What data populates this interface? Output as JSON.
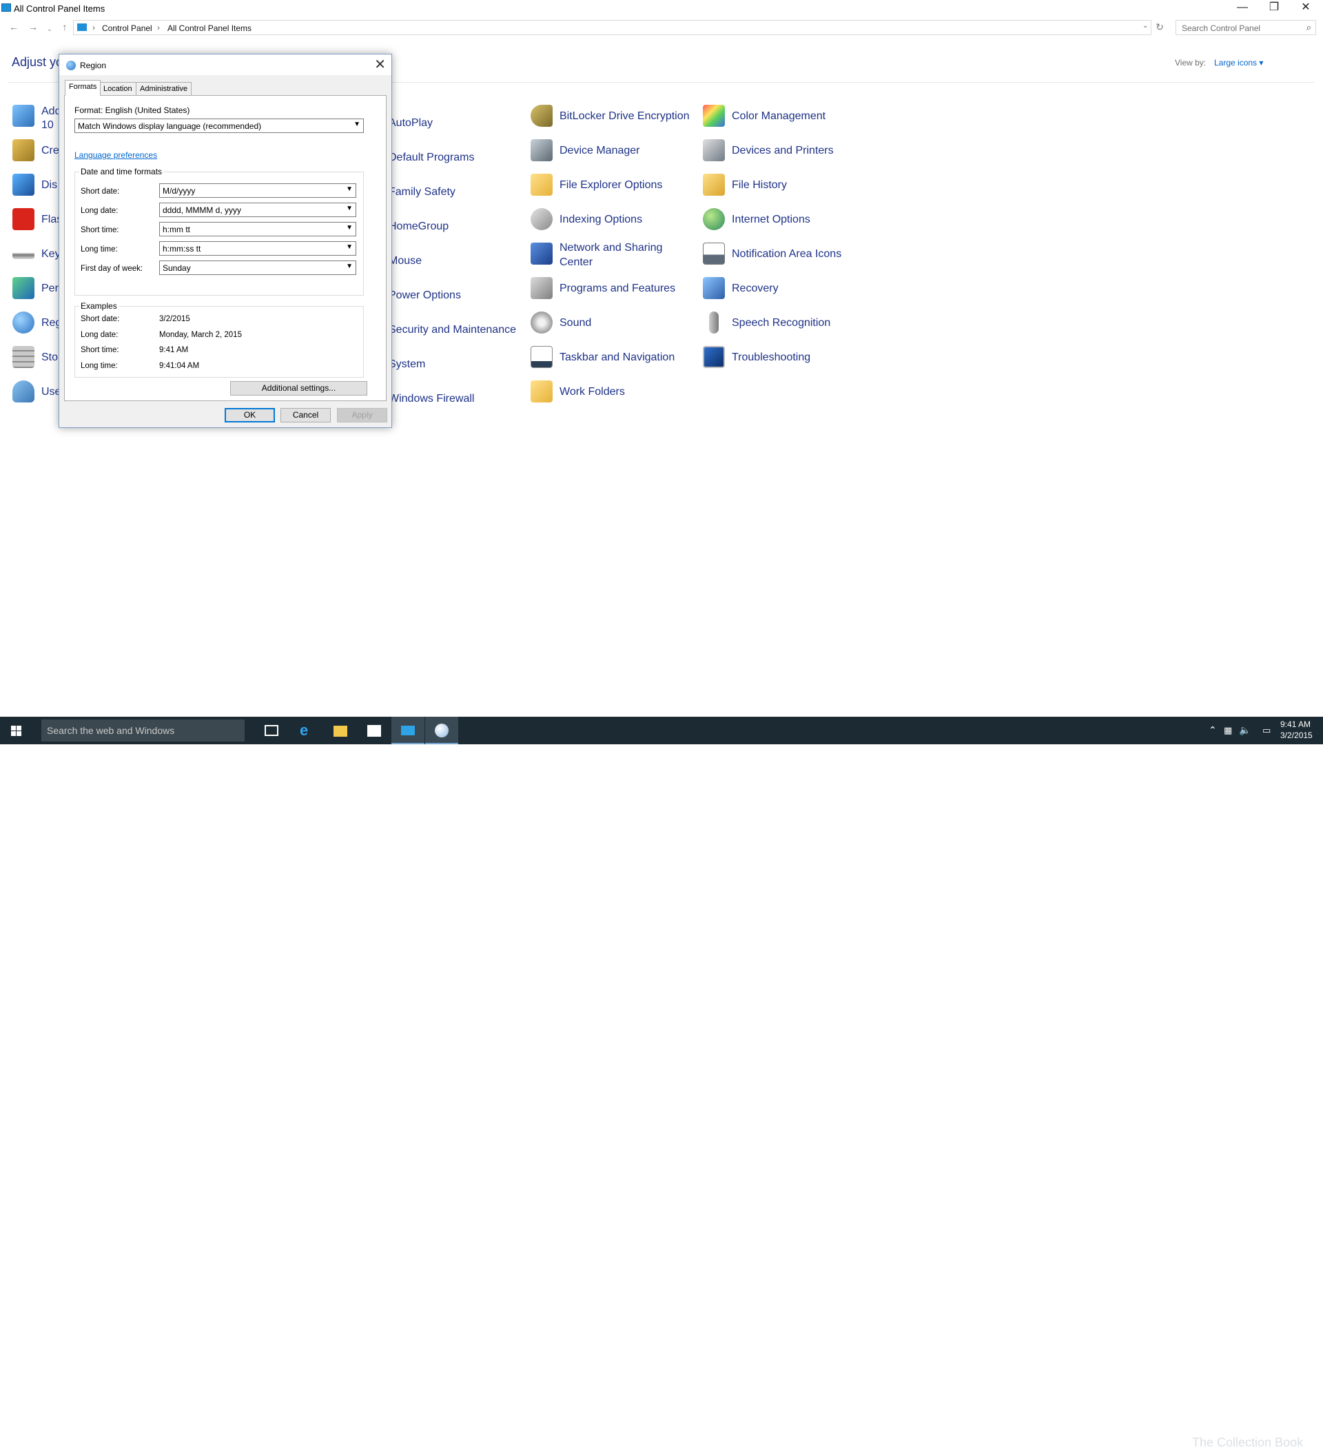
{
  "window": {
    "title": "All Control Panel Items",
    "minimize_glyph": "—",
    "restore_glyph": "❐",
    "close_glyph": "✕"
  },
  "address": {
    "crumbs": [
      "Control Panel",
      "All Control Panel Items"
    ],
    "search_placeholder": "Search Control Panel"
  },
  "header": {
    "title_partial": "Adjust you",
    "view_by_label": "View by:",
    "view_by_value": "Large icons ▾"
  },
  "items": {
    "col0": [
      "Add",
      "10",
      "Cre",
      "Dis",
      "Flas",
      "Key",
      "Per",
      "Reg",
      "Sto",
      "Use"
    ],
    "col1": [
      "AutoPlay",
      "Default Programs",
      "Family Safety",
      "HomeGroup",
      "Mouse",
      "Power Options",
      "Security and Maintenance",
      "System",
      "Windows Firewall"
    ],
    "col2": [
      "BitLocker Drive Encryption",
      "Device Manager",
      "File Explorer Options",
      "Indexing Options",
      "Network and Sharing",
      "Center",
      "Programs and Features",
      "Sound",
      "Taskbar and Navigation",
      "Work Folders"
    ],
    "col3": [
      "Color Management",
      "Devices and Printers",
      "File History",
      "Internet Options",
      "Notification Area Icons",
      "Recovery",
      "Speech Recognition",
      "Troubleshooting"
    ]
  },
  "dialog": {
    "title": "Region",
    "tabs": [
      "Formats",
      "Location",
      "Administrative"
    ],
    "format_label": "Format: English (United States)",
    "format_value": "Match Windows display language (recommended)",
    "language_link": "Language preferences",
    "dt_group": "Date and time formats",
    "rows": [
      {
        "label": "Short date:",
        "value": "M/d/yyyy"
      },
      {
        "label": "Long date:",
        "value": "dddd, MMMM d, yyyy"
      },
      {
        "label": "Short time:",
        "value": "h:mm tt"
      },
      {
        "label": "Long time:",
        "value": "h:mm:ss tt"
      },
      {
        "label": "First day of week:",
        "value": "Sunday"
      }
    ],
    "examples_group": "Examples",
    "examples": [
      {
        "label": "Short date:",
        "value": "3/2/2015"
      },
      {
        "label": "Long date:",
        "value": "Monday, March 2, 2015"
      },
      {
        "label": "Short time:",
        "value": "9:41 AM"
      },
      {
        "label": "Long time:",
        "value": "9:41:04 AM"
      }
    ],
    "additional_settings": "Additional settings...",
    "ok": "OK",
    "cancel": "Cancel",
    "apply": "Apply"
  },
  "taskbar": {
    "search_placeholder": "Search the web and Windows",
    "time": "9:41 AM",
    "date": "3/2/2015",
    "watermark": "The Collection Book"
  }
}
